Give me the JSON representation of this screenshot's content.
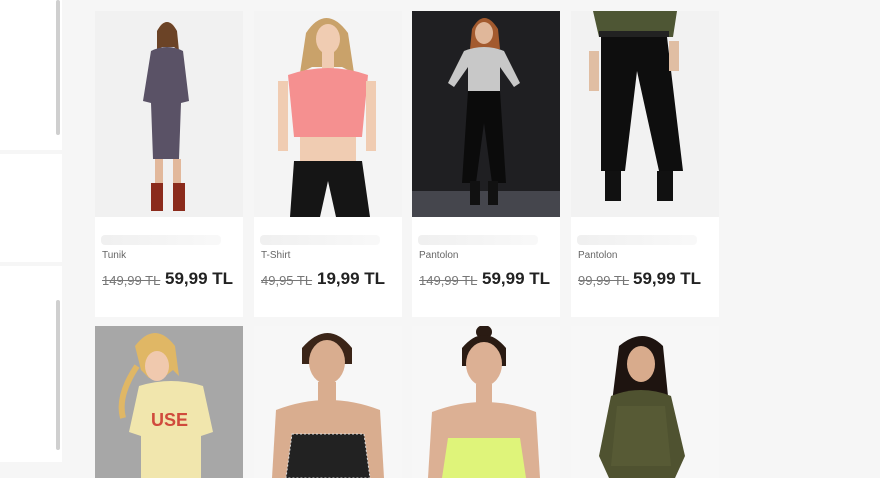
{
  "products": [
    {
      "category": "Tunik",
      "old_price": "149,99 TL",
      "new_price": "59,99 TL",
      "bg": "#f1f1f1"
    },
    {
      "category": "T-Shirt",
      "old_price": "49,95 TL",
      "new_price": "19,99 TL",
      "bg": "#f4f4f4"
    },
    {
      "category": "Pantolon",
      "old_price": "149,99 TL",
      "new_price": "59,99 TL",
      "bg": "#1f1f22"
    },
    {
      "category": "Pantolon",
      "old_price": "99,99 TL",
      "new_price": "59,99 TL",
      "bg": "#f2f2f2"
    },
    {
      "bg": "#a7a7a7"
    },
    {
      "bg": "#f7f7f7"
    },
    {
      "bg": "#f7f7f7"
    },
    {
      "bg": "#f7f7f7"
    }
  ]
}
